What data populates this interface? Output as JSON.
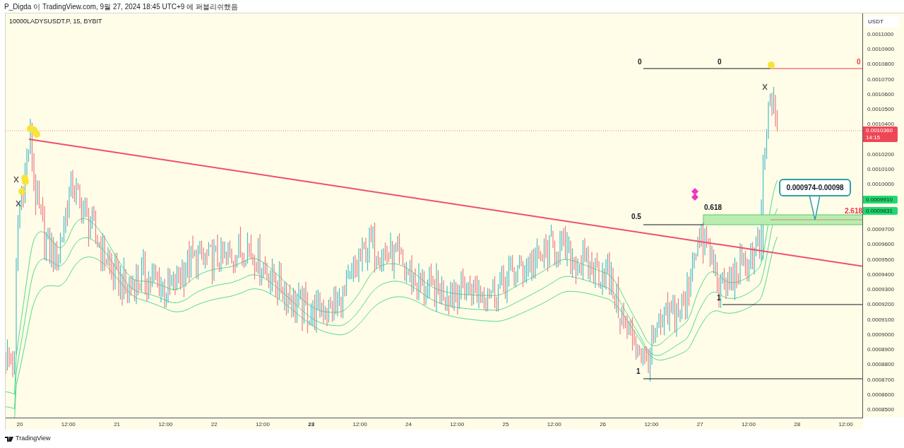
{
  "header": {
    "published_line": "P_Digda 이 TradingView.com, 9월 27, 2024 18:45 UTC+9 에 퍼블리쉬했음"
  },
  "chart": {
    "symbol": "10000LADYSUSDT.P, 15, BYBIT",
    "fib_labels": [
      {
        "text": "0",
        "color": "#131722"
      },
      {
        "text": "0",
        "color": "#131722"
      },
      {
        "text": "0",
        "color": "#f23645"
      },
      {
        "text": "0.5",
        "color": "#131722"
      },
      {
        "text": "0.618",
        "color": "#131722"
      },
      {
        "text": "2.618",
        "color": "#f23645"
      },
      {
        "text": "1",
        "color": "#131722"
      },
      {
        "text": "1",
        "color": "#131722"
      }
    ],
    "callout": {
      "text": "0.000974-0.00098"
    }
  },
  "price_axis": {
    "currency": "USDT",
    "ticks": [
      "0.0011000",
      "0.0010900",
      "0.0010800",
      "0.0010700",
      "0.0010600",
      "0.0010500",
      "0.0010400",
      "0.0010200",
      "0.0010100",
      "0.0010000",
      "0.0009700",
      "0.0009600",
      "0.0009500",
      "0.0009400",
      "0.0009300",
      "0.0009200",
      "0.0009100",
      "0.0009000",
      "0.0008900",
      "0.0008800",
      "0.0008700",
      "0.0008600",
      "0.0008500"
    ],
    "last_price": {
      "price": "0.0010360",
      "countdown": "14:15"
    },
    "tags": [
      {
        "price": "0.0009910"
      },
      {
        "price": "0.0009831"
      }
    ]
  },
  "time_axis": [
    {
      "label": "20",
      "bold": false
    },
    {
      "label": "12:00",
      "bold": false
    },
    {
      "label": "21",
      "bold": false
    },
    {
      "label": "12:00",
      "bold": false
    },
    {
      "label": "22",
      "bold": false
    },
    {
      "label": "12:00",
      "bold": false
    },
    {
      "label": "23",
      "bold": true
    },
    {
      "label": "12:00",
      "bold": false
    },
    {
      "label": "24",
      "bold": false
    },
    {
      "label": "12:00",
      "bold": false
    },
    {
      "label": "25",
      "bold": false
    },
    {
      "label": "12:00",
      "bold": false
    },
    {
      "label": "26",
      "bold": false
    },
    {
      "label": "12:00",
      "bold": false
    },
    {
      "label": "27",
      "bold": false
    },
    {
      "label": "12:00",
      "bold": false
    },
    {
      "label": "28",
      "bold": false
    },
    {
      "label": "12:00",
      "bold": false
    }
  ],
  "footer": {
    "brand": "TradingView"
  }
}
